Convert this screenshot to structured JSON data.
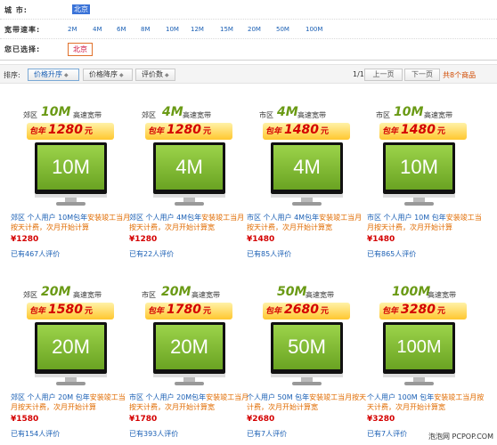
{
  "filters": {
    "city_label": "城 市:",
    "city_value": "北京",
    "speed_label": "宽带速率:",
    "speed_options": [
      "2M",
      "4M",
      "6M",
      "8M",
      "10M",
      "12M",
      "15M",
      "20M",
      "50M",
      "100M"
    ],
    "selected_label": "您已选择:",
    "selected_value": "北京"
  },
  "sortbar": {
    "label": "排序:",
    "sort_asc": "价格升序",
    "sort_desc": "价格降序",
    "sort_rating": "评价数",
    "page_info": "1/1",
    "prev": "上一页",
    "next": "下一页",
    "total": "共8个商品"
  },
  "products": [
    {
      "zone": "郊区",
      "speed": "10M",
      "tag": "高速宽带",
      "baonian": "包年",
      "price_big": "1280",
      "yuan": "元",
      "screen": "10M",
      "desc_blue": "郊区 个人用户 10M包年",
      "desc_orange": "安装竣工当月按天计费，次月开始计算",
      "price": "¥1280",
      "rating": "已有467人评价"
    },
    {
      "zone": "郊区",
      "speed": "4M",
      "tag": "高速宽带",
      "baonian": "包年",
      "price_big": "1280",
      "yuan": "元",
      "screen": "4M",
      "desc_blue": "郊区 个人用户 4M包年",
      "desc_orange": "安装竣工当月按天计费，次月开始计算宽",
      "price": "¥1280",
      "rating": "已有22人评价"
    },
    {
      "zone": "市区",
      "speed": "4M",
      "tag": "高速宽带",
      "baonian": "包年",
      "price_big": "1480",
      "yuan": "元",
      "screen": "4M",
      "desc_blue": "市区 个人用户 4M包年",
      "desc_orange": "安装竣工当月按天计费，次月开始计算宽",
      "price": "¥1480",
      "rating": "已有85人评价"
    },
    {
      "zone": "市区",
      "speed": "10M",
      "tag": "高速宽带",
      "baonian": "包年",
      "price_big": "1480",
      "yuan": "元",
      "screen": "10M",
      "desc_blue": "市区 个人用户 10M 包年",
      "desc_orange": "安装竣工当月按天计费，次月开始计算",
      "price": "¥1480",
      "rating": "已有865人评价"
    },
    {
      "zone": "郊区",
      "speed": "20M",
      "tag": "高速宽带",
      "baonian": "包年",
      "price_big": "1580",
      "yuan": "元",
      "screen": "20M",
      "desc_blue": "郊区 个人用户 20M 包年",
      "desc_orange": "安装竣工当月按天计费，次月开始计算",
      "price": "¥1580",
      "rating": "已有154人评价"
    },
    {
      "zone": "市区",
      "speed": "20M",
      "tag": "高速宽带",
      "baonian": "包年",
      "price_big": "1780",
      "yuan": "元",
      "screen": "20M",
      "desc_blue": "市区 个人用户 20M包年",
      "desc_orange": "安装竣工当月按天计费，次月开始计算宽",
      "price": "¥1780",
      "rating": "已有393人评价"
    },
    {
      "zone": "",
      "speed": "50M",
      "tag": "高速宽带",
      "baonian": "包年",
      "price_big": "2680",
      "yuan": "元",
      "screen": "50M",
      "desc_blue": "个人用户 50M 包年",
      "desc_orange": "安装竣工当月按天计费，次月开始计算宽",
      "price": "¥2680",
      "rating": "已有7人评价"
    },
    {
      "zone": "",
      "speed": "100M",
      "tag": "高速宽带",
      "baonian": "包年",
      "price_big": "3280",
      "yuan": "元",
      "screen": "100M",
      "desc_blue": "个人用户 100M 包年",
      "desc_orange": "安装竣工当月按天计费，次月开始计算宽",
      "price": "¥3280",
      "rating": "已有7人评价"
    }
  ],
  "watermark": "泡泡网 PCPOP.COM"
}
